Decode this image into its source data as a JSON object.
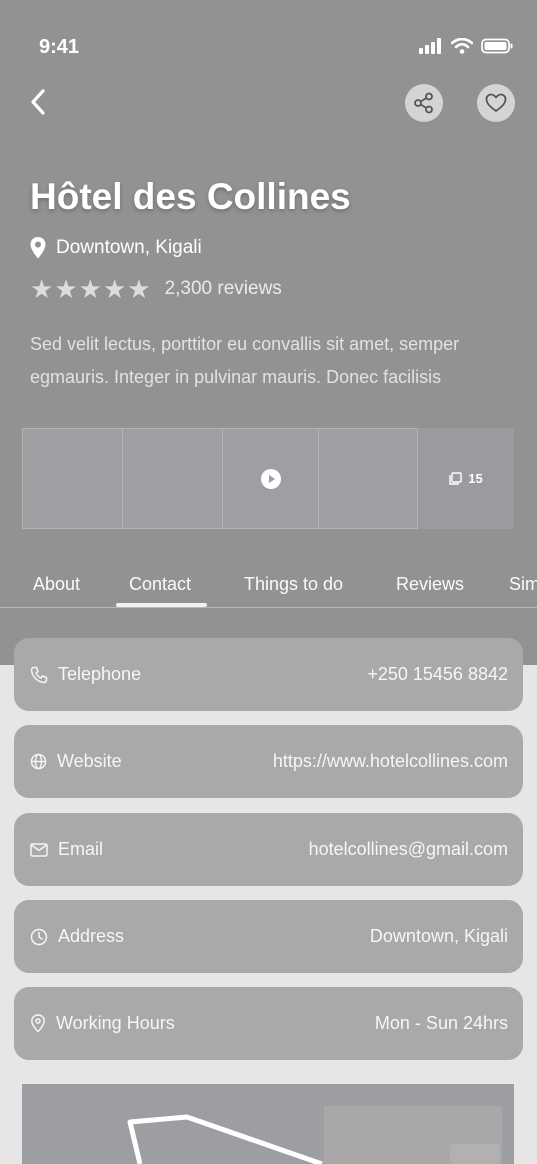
{
  "status_bar": {
    "time": "9:41"
  },
  "hotel": {
    "name": "Hôtel des Collines",
    "location": "Downtown, Kigali",
    "rating_stars": 5,
    "reviews": "2,300 reviews",
    "description": "Sed velit lectus, porttitor eu convallis sit amet, semper egmauris. Integer in pulvinar mauris. Donec facilisis"
  },
  "gallery": {
    "more_count": "15"
  },
  "tabs": [
    {
      "label": "About"
    },
    {
      "label": "Contact"
    },
    {
      "label": "Things to do"
    },
    {
      "label": "Reviews"
    },
    {
      "label": "Similar"
    }
  ],
  "active_tab": "Contact",
  "contact": [
    {
      "icon": "phone-icon",
      "label": "Telephone",
      "value": "+250 15456 8842"
    },
    {
      "icon": "globe-icon",
      "label": "Website",
      "value": "https://www.hotelcollines.com"
    },
    {
      "icon": "mail-icon",
      "label": "Email",
      "value": "hotelcollines@gmail.com"
    },
    {
      "icon": "clock-icon",
      "label": "Address",
      "value": "Downtown, Kigali"
    },
    {
      "icon": "location-pin-icon",
      "label": "Working Hours",
      "value": "Mon - Sun  24hrs"
    }
  ],
  "colors": {
    "hero_overlay": "#929292",
    "card_background": "#a9a9a9",
    "page_background": "#e6e6e6"
  }
}
